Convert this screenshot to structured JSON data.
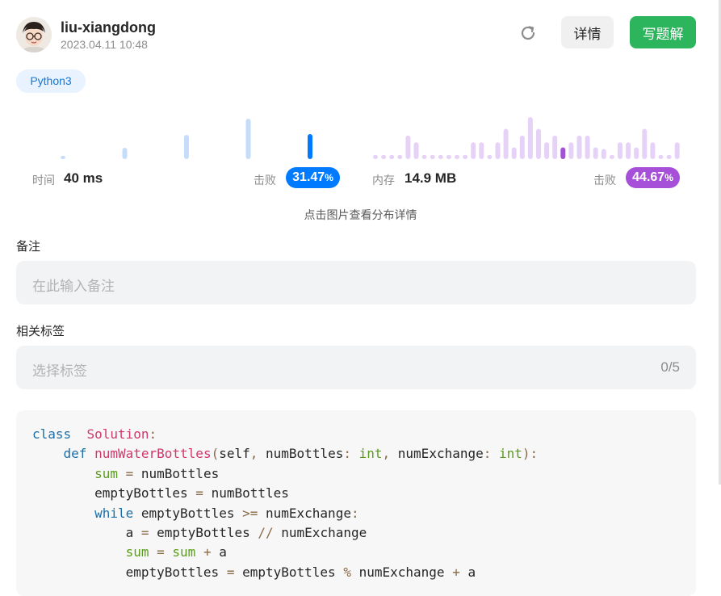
{
  "header": {
    "user_name": "liu-xiangdong",
    "timestamp": "2023.04.11 10:48",
    "detail_label": "详情",
    "write_solution_label": "写题解"
  },
  "language": "Python3",
  "runtime": {
    "label": "时间",
    "value": "40 ms",
    "beat_label": "击败",
    "beat_int": "31.47",
    "beat_unit": "%",
    "color": "#007aff",
    "bar_color": "#c5ddfb",
    "bars": [
      0.08,
      0.28,
      0.6,
      1.0,
      0.62
    ],
    "highlight_index": 4
  },
  "memory": {
    "label": "内存",
    "value": "14.9 MB",
    "beat_label": "击败",
    "beat_int": "44.67",
    "beat_unit": "%",
    "color": "#a64fd8",
    "bar_color": "#e6d2f7",
    "bars": [
      0.1,
      0.1,
      0.1,
      0.1,
      0.56,
      0.4,
      0.1,
      0.1,
      0.1,
      0.1,
      0.1,
      0.1,
      0.4,
      0.4,
      0.1,
      0.4,
      0.72,
      0.28,
      0.56,
      1.0,
      0.72,
      0.4,
      0.56,
      0.28,
      0.4,
      0.56,
      0.56,
      0.28,
      0.24,
      0.1,
      0.4,
      0.4,
      0.28,
      0.72,
      0.4,
      0.1,
      0.1,
      0.4
    ],
    "highlight_index": 23
  },
  "hint": "点击图片查看分布详情",
  "notes": {
    "label": "备注",
    "placeholder": "在此输入备注"
  },
  "tags": {
    "label": "相关标签",
    "placeholder": "选择标签",
    "count": "0/5"
  },
  "code": [
    [
      [
        "kw",
        "class"
      ],
      [
        "",
        "  "
      ],
      [
        "fn",
        "Solution"
      ],
      [
        "op",
        ":"
      ]
    ],
    [
      [
        "",
        "    "
      ],
      [
        "kw",
        "def"
      ],
      [
        "",
        " "
      ],
      [
        "fn",
        "numWaterBottles"
      ],
      [
        "op",
        "("
      ],
      [
        "",
        "self"
      ],
      [
        "op",
        ", "
      ],
      [
        "",
        "numBottles"
      ],
      [
        "op",
        ": "
      ],
      [
        "ty",
        "int"
      ],
      [
        "op",
        ", "
      ],
      [
        "",
        "numExchange"
      ],
      [
        "op",
        ": "
      ],
      [
        "ty",
        "int"
      ],
      [
        "op",
        "):"
      ]
    ],
    [
      [
        "",
        "        "
      ],
      [
        "var",
        "sum"
      ],
      [
        "op",
        " = "
      ],
      [
        "",
        "numBottles"
      ]
    ],
    [
      [
        "",
        "        "
      ],
      [
        "",
        "emptyBottles"
      ],
      [
        "op",
        " = "
      ],
      [
        "",
        "numBottles"
      ]
    ],
    [
      [
        "",
        "        "
      ],
      [
        "kw",
        "while"
      ],
      [
        "",
        " emptyBottles "
      ],
      [
        "op",
        ">="
      ],
      [
        "",
        " numExchange"
      ],
      [
        "op",
        ":"
      ]
    ],
    [
      [
        "",
        "            "
      ],
      [
        "",
        "a"
      ],
      [
        "op",
        " = "
      ],
      [
        "",
        "emptyBottles "
      ],
      [
        "op",
        "//"
      ],
      [
        "",
        " numExchange"
      ]
    ],
    [
      [
        "",
        "            "
      ],
      [
        "var",
        "sum"
      ],
      [
        "op",
        " = "
      ],
      [
        "var",
        "sum"
      ],
      [
        "op",
        " + "
      ],
      [
        "",
        "a"
      ]
    ],
    [
      [
        "",
        "            "
      ],
      [
        "",
        "emptyBottles"
      ],
      [
        "op",
        " = "
      ],
      [
        "",
        "emptyBottles "
      ],
      [
        "op",
        "%"
      ],
      [
        "",
        " numExchange "
      ],
      [
        "op",
        "+"
      ],
      [
        "",
        " a"
      ]
    ]
  ]
}
